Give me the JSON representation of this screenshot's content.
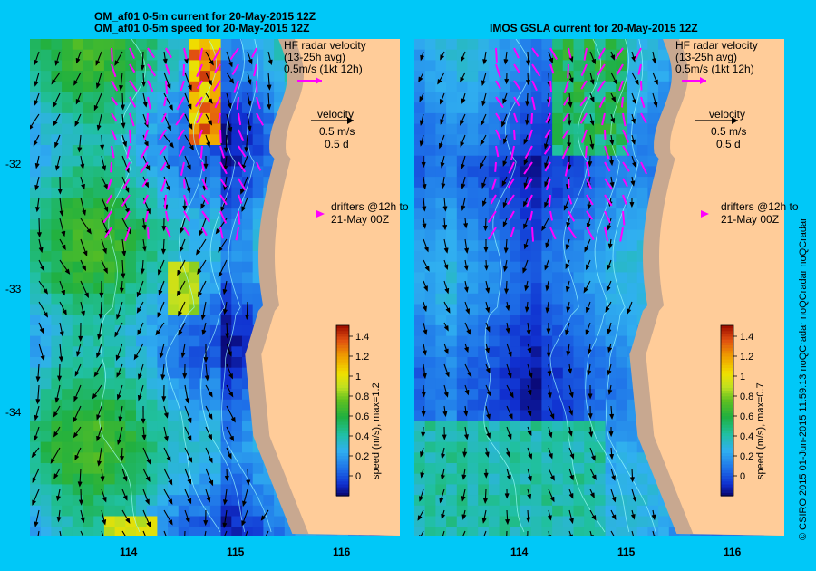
{
  "left_panel": {
    "title_line1": "OM_af01 0-5m current for 20-May-2015 12Z",
    "title_line2": "OM_af01 0-5m speed for 20-May-2015 12Z",
    "colorbar_label": "speed (m/s), max=1.2",
    "max_speed": 1.2
  },
  "right_panel": {
    "title": "IMOS GSLA current for 20-May-2015 12Z",
    "colorbar_label": "speed (m/s), max=0.7",
    "max_speed": 0.7
  },
  "legend": {
    "hf_title": "HF radar velocity",
    "hf_avg": "(13-25h avg)",
    "hf_scale": "0.5m/s (1kt 12h)",
    "velocity_title": "velocity",
    "velocity_speed": "0.5 m/s",
    "velocity_days": "0.5 d",
    "drifters_line1": "drifters @12h to",
    "drifters_line2": "21-May 00Z"
  },
  "colorbar_ticks": [
    "1.4",
    "1.2",
    "1",
    "0.8",
    "0.6",
    "0.4",
    "0.2",
    "0"
  ],
  "axes": {
    "x_ticks": [
      "114",
      "115",
      "116"
    ],
    "y_ticks": [
      "-32",
      "-33",
      "-34"
    ]
  },
  "credit": "© CSIRO 2015   01-Jun-2015 11:59:13 noQCradar noQCradar noQCradar",
  "colors": {
    "background": "#00c8f8",
    "land": "#ffcc99",
    "shelf": "#c8a890",
    "arrow": "#000000",
    "hf_arrow": "#ff00ff",
    "contour": "#a0ffff"
  }
}
